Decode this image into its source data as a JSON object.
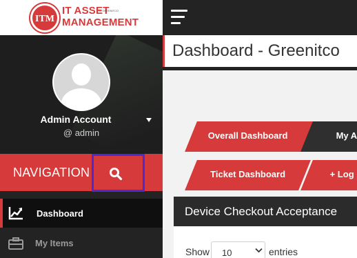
{
  "logo": {
    "badge": "ITM",
    "line1": "IT ASSET",
    "by": "by GREENITCO",
    "line2": "MANAGEMENT"
  },
  "user": {
    "name": "Admin Account",
    "handle": "@ admin"
  },
  "navigation": {
    "title": "NAVIGATION",
    "items": [
      {
        "label": "Dashboard",
        "icon": "line-chart-icon",
        "active": true
      },
      {
        "label": "My Items",
        "icon": "briefcase-icon",
        "active": false
      }
    ]
  },
  "page": {
    "title": "Dashboard - Greenitco"
  },
  "tabs": {
    "row1": [
      {
        "label": "Overall Dashboard"
      },
      {
        "label": "My A"
      }
    ],
    "row2": [
      {
        "label": "Ticket Dashboard"
      },
      {
        "label": "+ Log"
      }
    ]
  },
  "panel": {
    "title": "Device Checkout Acceptance",
    "show_label": "Show",
    "entries_value": "10",
    "entries_label": "entries"
  },
  "colors": {
    "accent": "#d63a3a",
    "sidebar": "#232323",
    "highlight_border": "#4b2ad6"
  }
}
